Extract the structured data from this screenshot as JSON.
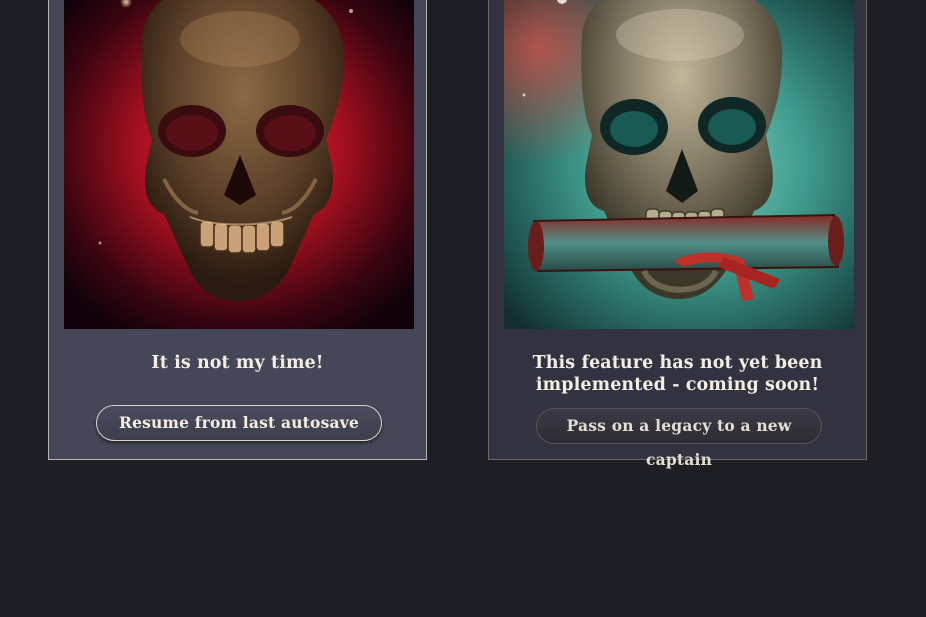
{
  "cards": [
    {
      "image_icon": "skull-red-portrait",
      "text": "It is not my time!",
      "button_label": "Resume from last autosave",
      "accent": "#c8172c"
    },
    {
      "image_icon": "skull-scroll-teal-portrait",
      "text_line1": "This feature has not yet been",
      "text_line2": "implemented - coming soon!",
      "button_label": "Pass on a legacy to a new captain",
      "accent": "#3fa898"
    }
  ],
  "colors": {
    "background": "#1e1f24",
    "card_left_bg": "#454657",
    "card_right_bg": "#333240",
    "text": "#f3eee4"
  }
}
